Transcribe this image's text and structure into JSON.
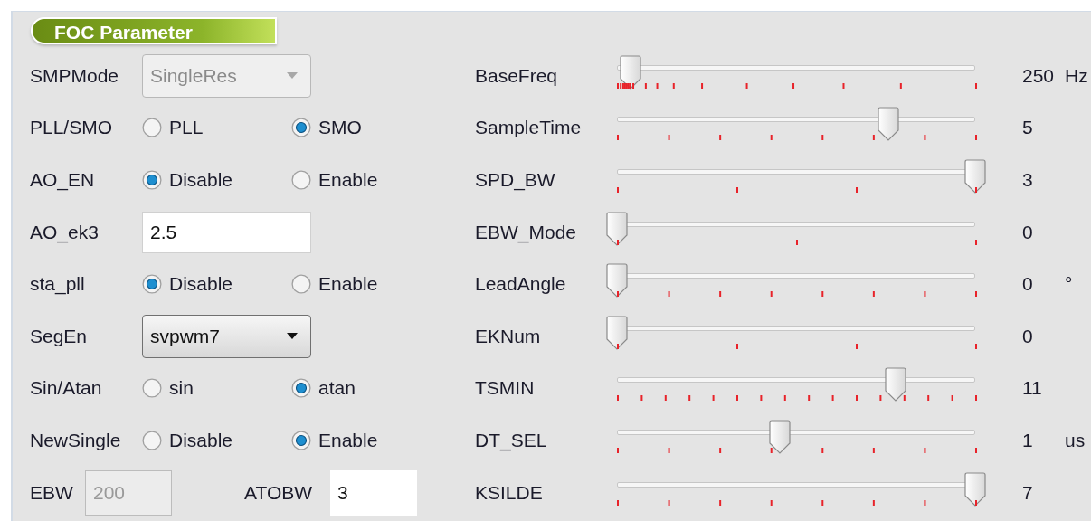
{
  "panel": {
    "title": "FOC Parameter",
    "left_rows": [
      {
        "kind": "dropdown",
        "label": "SMPMode",
        "value": "SingleRes",
        "disabled": true
      },
      {
        "kind": "radio",
        "label": "PLL/SMO",
        "options": [
          {
            "label": "PLL",
            "selected": false
          },
          {
            "label": "SMO",
            "selected": true
          }
        ]
      },
      {
        "kind": "radio",
        "label": "AO_EN",
        "options": [
          {
            "label": "Disable",
            "selected": true
          },
          {
            "label": "Enable",
            "selected": false
          }
        ]
      },
      {
        "kind": "input",
        "label": "AO_ek3",
        "value": "2.5"
      },
      {
        "kind": "radio",
        "label": "sta_pll",
        "options": [
          {
            "label": "Disable",
            "selected": true
          },
          {
            "label": "Enable",
            "selected": false
          }
        ]
      },
      {
        "kind": "dropdown",
        "label": "SegEn",
        "value": "svpwm7",
        "disabled": false
      },
      {
        "kind": "radio",
        "label": "Sin/Atan",
        "options": [
          {
            "label": "sin",
            "selected": false
          },
          {
            "label": "atan",
            "selected": true
          }
        ]
      },
      {
        "kind": "radio",
        "label": "NewSingle",
        "options": [
          {
            "label": "Disable",
            "selected": false
          },
          {
            "label": "Enable",
            "selected": true
          }
        ]
      },
      {
        "kind": "pair",
        "fields": [
          {
            "label": "EBW",
            "value": "200",
            "disabled": true
          },
          {
            "label": "ATOBW",
            "value": "3",
            "disabled": false
          }
        ]
      }
    ],
    "sliders": [
      {
        "label": "BaseFreq",
        "level": 0.035,
        "kind": "log",
        "reading": "250",
        "unit": "Hz"
      },
      {
        "label": "SampleTime",
        "level": 0.714,
        "kind": "sevenths",
        "reading": "5"
      },
      {
        "label": "SPD_BW",
        "level": 1,
        "kind": "thirds",
        "reading": "3"
      },
      {
        "label": "EBW_Mode",
        "level": 0,
        "kind": "halves",
        "reading": "0"
      },
      {
        "label": "LeadAngle",
        "level": 0,
        "kind": "sevenths",
        "reading": "0",
        "unit": "°"
      },
      {
        "label": "EKNum",
        "level": 0,
        "kind": "thirds",
        "reading": "0"
      },
      {
        "label": "TSMIN",
        "level": 0.733,
        "kind": "fifteenths",
        "reading": "11"
      },
      {
        "label": "DT_SEL",
        "level": 0.429,
        "kind": "sevenths",
        "reading": "1",
        "unit": "us"
      },
      {
        "label": "KSILDE",
        "level": 1,
        "kind": "sevenths",
        "reading": "7"
      }
    ]
  }
}
